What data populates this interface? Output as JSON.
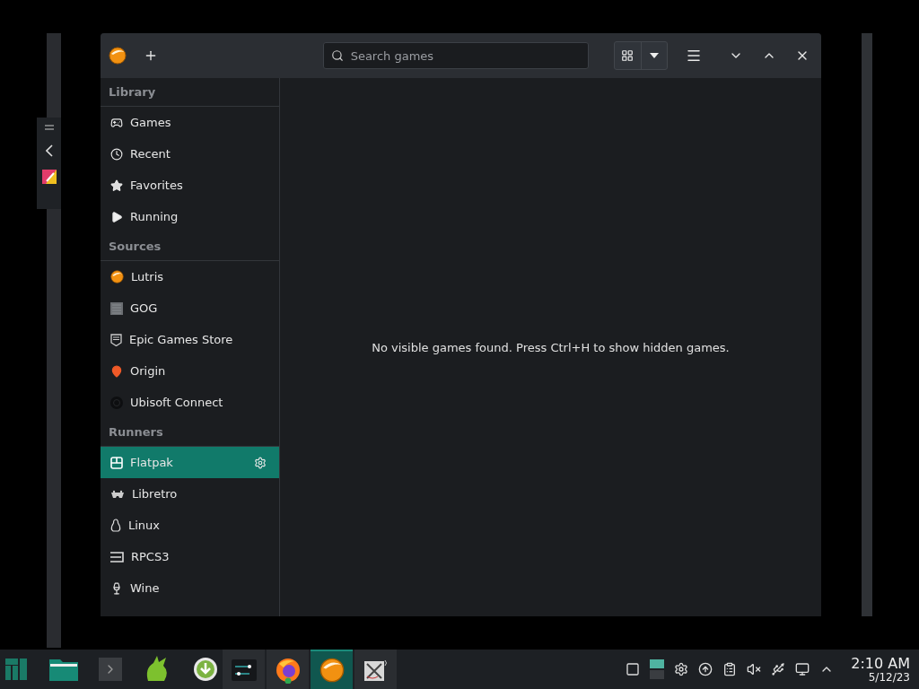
{
  "window": {
    "search": {
      "placeholder": "Search games"
    }
  },
  "sidebar": {
    "sections": [
      {
        "title": "Library",
        "items": [
          {
            "label": "Games",
            "selected": false
          },
          {
            "label": "Recent",
            "selected": false
          },
          {
            "label": "Favorites",
            "selected": false
          },
          {
            "label": "Running",
            "selected": false
          }
        ]
      },
      {
        "title": "Sources",
        "items": [
          {
            "label": "Lutris",
            "selected": false
          },
          {
            "label": "GOG",
            "selected": false
          },
          {
            "label": "Epic Games Store",
            "selected": false
          },
          {
            "label": "Origin",
            "selected": false
          },
          {
            "label": "Ubisoft Connect",
            "selected": false
          }
        ]
      },
      {
        "title": "Runners",
        "items": [
          {
            "label": "Flatpak",
            "selected": true
          },
          {
            "label": "Libretro",
            "selected": false
          },
          {
            "label": "Linux",
            "selected": false
          },
          {
            "label": "RPCS3",
            "selected": false
          },
          {
            "label": "Wine",
            "selected": false
          }
        ]
      }
    ]
  },
  "content": {
    "message": "No visible games found. Press Ctrl+H to show hidden games."
  },
  "taskbar": {
    "tasks": [
      {
        "selected": false
      },
      {
        "selected": false
      },
      {
        "selected": true
      },
      {
        "selected": false
      }
    ],
    "clock": {
      "time": "2:10 AM",
      "date": "5/12/23"
    }
  }
}
